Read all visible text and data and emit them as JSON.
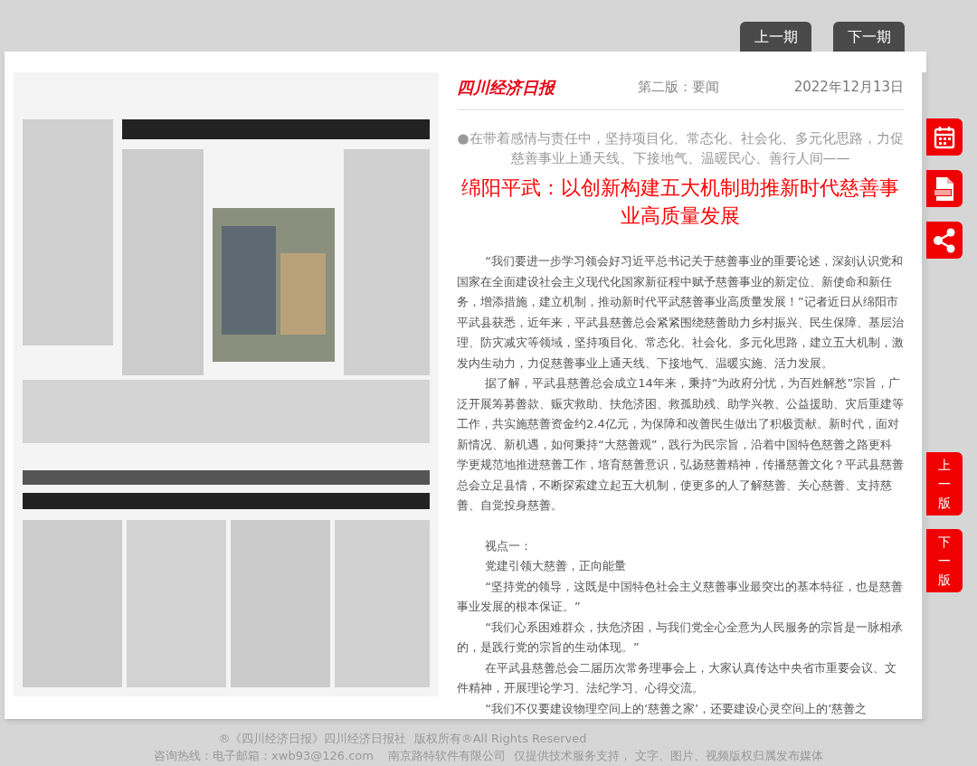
{
  "issue_nav": [
    "上一期",
    "下一期"
  ],
  "masthead": {
    "logo": "四川经济日报",
    "edition": "第二版：要闻",
    "date": "2022年12月13日"
  },
  "article": {
    "lead": "●在带着感情与责任中，坚持项目化、常态化、社会化、多元化思路，力促慈善事业上通天线、下接地气、温暖民心、善行人间——",
    "title": "绵阳平武：以创新构建五大机制助推新时代慈善事业高质量发展",
    "sections": [
      {
        "paragraphs": [
          "“我们要进一步学习领会好习近平总书记关于慈善事业的重要论述，深刻认识党和国家在全面建设社会主义现代化国家新征程中赋予慈善事业的新定位、新使命和新任务，增添措施，建立机制，推动新时代平武慈善事业高质量发展！”记者近日从绵阳市平武县获悉，近年来，平武县慈善总会紧紧围绕慈善助力乡村振兴、民生保障、基层治理、防灾减灾等领域，坚持项目化、常态化、社会化、多元化思路，建立五大机制，激发内生动力，力促慈善事业上通天线、下接地气、温暖实施、活力发展。",
          "据了解，平武县慈善总会成立14年来，秉持“为政府分忧，为百姓解愁”宗旨，广泛开展筹募善款、赈灾救助、扶危济困、救孤助残、助学兴教、公益援助、灾后重建等工作，共实施慈善资金约2.4亿元，为保障和改善民生做出了积极贡献。新时代，面对新情况、新机遇，如何秉持“大慈善观”，践行为民宗旨，沿着中国特色慈善之路更科学更规范地推进慈善工作，培育慈善意识，弘扬慈善精神，传播慈善文化？平武县慈善总会立足县情，不断探索建立起五大机制，使更多的人了解慈善、关心慈善、支持慈善、自觉投身慈善。"
        ]
      },
      {
        "paragraphs": [
          "视点一：",
          "党建引领大慈善，正向能量",
          "“坚持党的领导，这既是中国特色社会主义慈善事业最突出的基本特征，也是慈善事业发展的根本保证。”",
          "“我们心系困难群众，扶危济困，与我们党全心全意为人民服务的宗旨是一脉相承的，是践行党的宗旨的生动体现。”",
          "在平武县慈善总会二届历次常务理事会上，大家认真传达中央省市重要会议、文件精神，开展理论学习、法纪学习、心得交流。",
          "“我们不仅要建设物理空间上的‘慈善之家’，还要建设心灵空间上的‘慈善之"
        ]
      }
    ]
  },
  "page_nav": [
    "上一版",
    "下一版"
  ],
  "footer": [
    "®《四川经济日报》四川经济日报社  版权所有®All Rights Reserved",
    "咨询热线：电子邮箱：xwb93@126.com    南京路特软件有限公司  仅提供技术服务支持， 文字、图片、视频版权归属发布媒体"
  ]
}
